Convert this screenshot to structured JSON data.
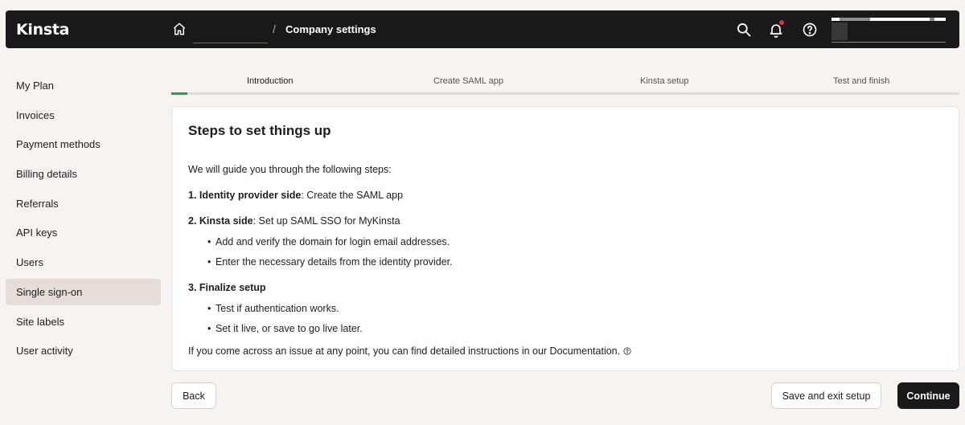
{
  "header": {
    "logo_text": "Kinsta",
    "breadcrumb_current": "Company settings",
    "breadcrumb_separator": "/",
    "icons": [
      "home-icon",
      "search-icon",
      "bell-icon",
      "help-icon"
    ]
  },
  "sidebar": {
    "items": [
      {
        "label": "My Plan"
      },
      {
        "label": "Invoices"
      },
      {
        "label": "Payment methods"
      },
      {
        "label": "Billing details"
      },
      {
        "label": "Referrals"
      },
      {
        "label": "API keys"
      },
      {
        "label": "Users"
      },
      {
        "label": "Single sign-on",
        "active": true
      },
      {
        "label": "Site labels"
      },
      {
        "label": "User activity"
      }
    ]
  },
  "wizard": {
    "steps": [
      {
        "label": "Introduction",
        "current": true
      },
      {
        "label": "Create SAML app"
      },
      {
        "label": "Kinsta setup"
      },
      {
        "label": "Test and finish"
      }
    ],
    "progress_percent": 2,
    "progress_color": "#1da343"
  },
  "card": {
    "title": "Steps to set things up",
    "intro": "We will guide you through the following steps:",
    "step1_bold": "1. Identity provider side",
    "step1_rest": ": Create the SAML app",
    "step2_bold": "2. Kinsta side",
    "step2_rest": ": Set up SAML SSO for MyKinsta",
    "step2_bullets": [
      "Add and verify the domain for login email addresses.",
      "Enter the necessary details from the identity provider."
    ],
    "step3_bold": "3. Finalize setup",
    "step3_bullets": [
      "Test if authentication works.",
      "Set it live, or save to go live later."
    ],
    "footer_text": "If you come across an issue at any point, you can find detailed instructions in our Documentation."
  },
  "actions": {
    "back_label": "Back",
    "save_label": "Save and exit setup",
    "continue_label": "Continue"
  }
}
